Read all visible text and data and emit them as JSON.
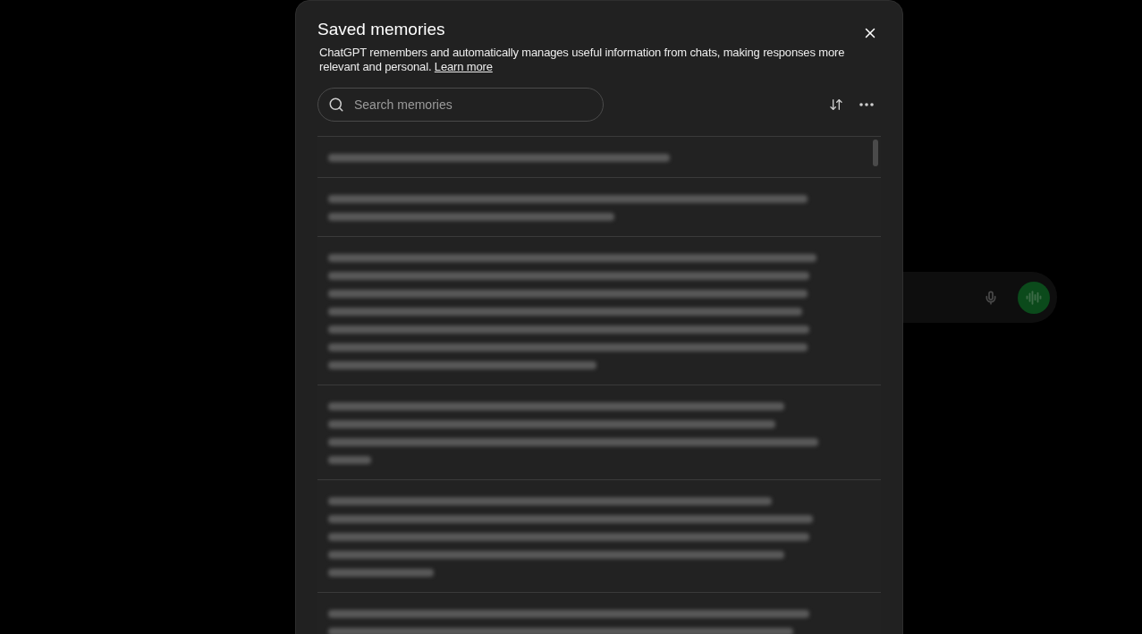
{
  "modal": {
    "title": "Saved memories",
    "description": "ChatGPT remembers and automatically manages useful information from chats, making responses more relevant and personal.",
    "link": "Learn more",
    "search": {
      "placeholder": "Search memories"
    }
  }
}
